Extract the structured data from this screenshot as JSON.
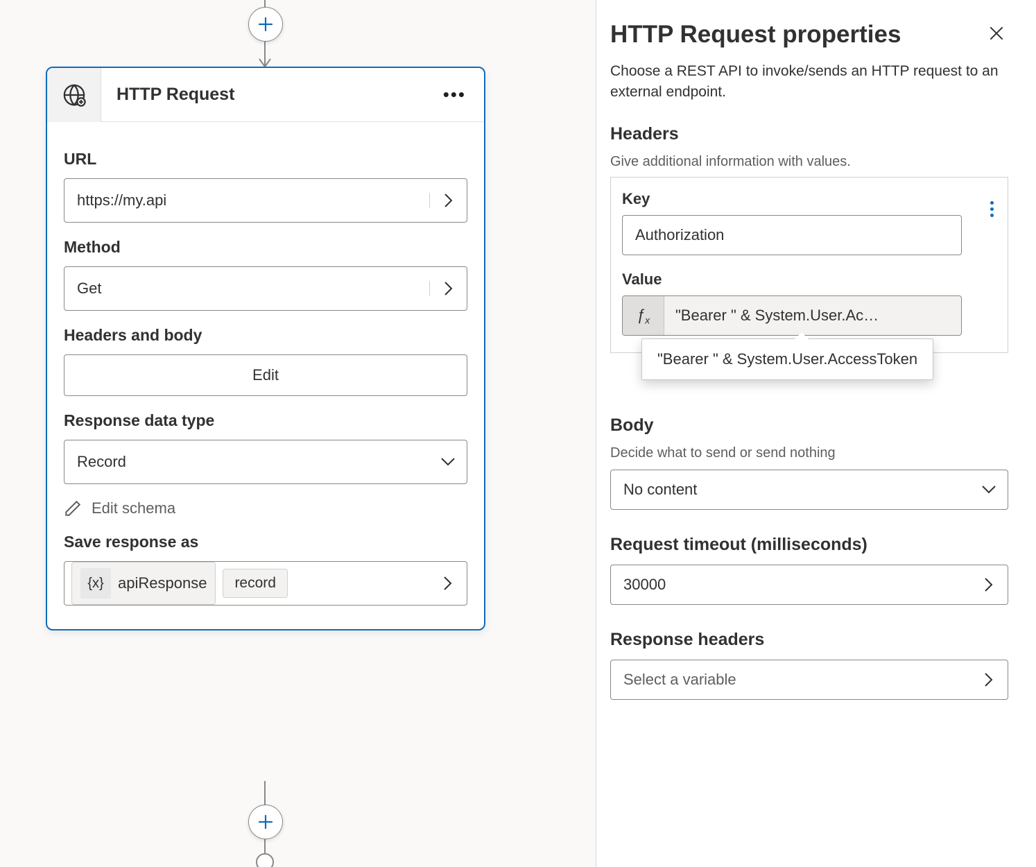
{
  "canvas": {
    "card_title": "HTTP Request",
    "fields": {
      "url_label": "URL",
      "url_value": "https://my.api",
      "method_label": "Method",
      "method_value": "Get",
      "headers_label": "Headers and body",
      "edit_button": "Edit",
      "datatype_label": "Response data type",
      "datatype_value": "Record",
      "edit_schema": "Edit schema",
      "save_as_label": "Save response as",
      "var_name": "apiResponse",
      "var_type": "record"
    }
  },
  "panel": {
    "title": "HTTP Request properties",
    "description": "Choose a REST API to invoke/sends an HTTP request to an external endpoint.",
    "headers": {
      "title": "Headers",
      "sub": "Give additional information with values.",
      "key_label": "Key",
      "key_value": "Authorization",
      "value_label": "Value",
      "value_expr_short": "\"Bearer \" & System.User.Ac…",
      "value_expr_full": "\"Bearer \" & System.User.AccessToken"
    },
    "body": {
      "title": "Body",
      "sub": "Decide what to send or send nothing",
      "value": "No content"
    },
    "timeout": {
      "label": "Request timeout (milliseconds)",
      "value": "30000"
    },
    "response_headers": {
      "label": "Response headers",
      "placeholder": "Select a variable"
    }
  }
}
